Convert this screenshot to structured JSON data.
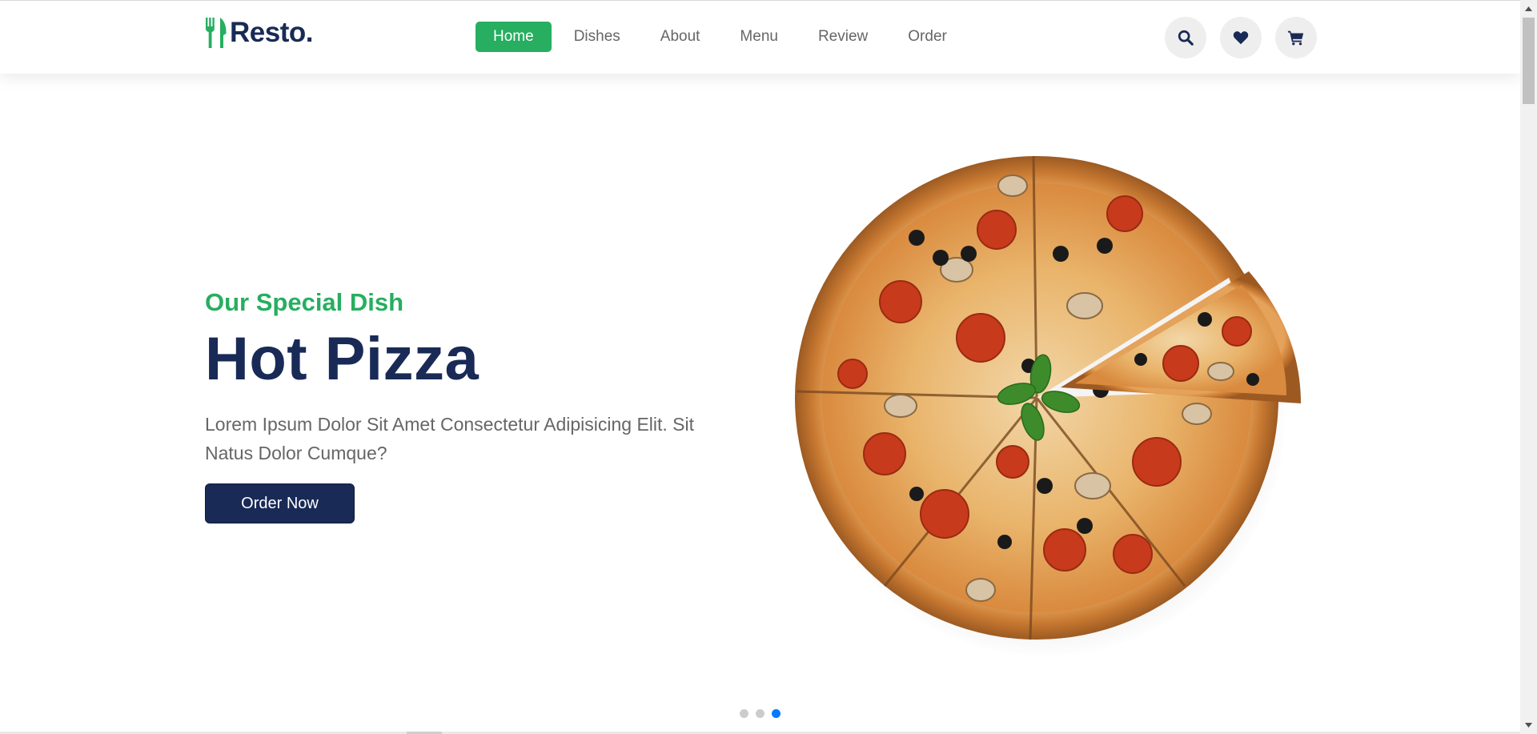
{
  "app": {
    "brand": "Resto."
  },
  "nav": {
    "items": [
      {
        "label": "Home",
        "active": true
      },
      {
        "label": "Dishes",
        "active": false
      },
      {
        "label": "About",
        "active": false
      },
      {
        "label": "Menu",
        "active": false
      },
      {
        "label": "Review",
        "active": false
      },
      {
        "label": "Order",
        "active": false
      }
    ]
  },
  "header_icons": [
    "search-icon",
    "heart-icon",
    "cart-icon"
  ],
  "hero": {
    "subtitle": "Our Special Dish",
    "title": "Hot Pizza",
    "description": "Lorem Ipsum Dolor Sit Amet Consectetur Adipisicing Elit. Sit Natus Dolor Cumque?",
    "button": "Order Now",
    "image": "pizza"
  },
  "carousel": {
    "slides": 3,
    "active_index": 2
  },
  "colors": {
    "accent_green": "#27ae60",
    "navy": "#192a56",
    "text_gray": "#666666",
    "dot_active": "#007aff"
  }
}
